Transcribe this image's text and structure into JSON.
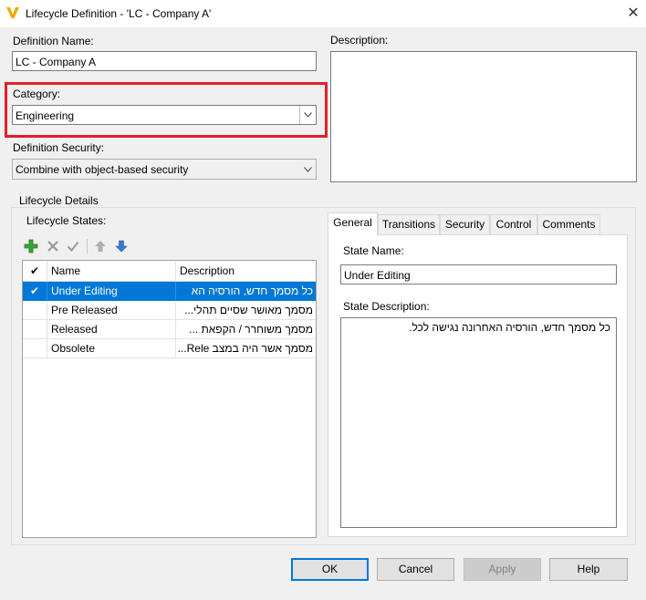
{
  "window": {
    "title": "Lifecycle Definition - 'LC - Company A'",
    "close_glyph": "✕"
  },
  "definition_name": {
    "label": "Definition Name:",
    "value": "LC - Company A"
  },
  "description": {
    "label": "Description:",
    "value": ""
  },
  "category": {
    "label": "Category:",
    "selected": "Engineering"
  },
  "definition_security": {
    "label": "Definition Security:",
    "selected": "Combine with object-based security"
  },
  "lifecycle_details": {
    "label": "Lifecycle Details",
    "states_label": "Lifecycle States:",
    "toolbar": [
      "add-icon",
      "delete-icon",
      "check-icon",
      "move-up-icon",
      "move-down-icon"
    ],
    "columns": [
      "✔",
      "Name",
      "Description"
    ],
    "states": [
      {
        "check": "✔",
        "name": "Under Editing",
        "description": "כל מסמך חדש, הורסיה הא"
      },
      {
        "check": "",
        "name": "Pre Released",
        "description": "מסמך מאושר שסיים תהלי..."
      },
      {
        "check": "",
        "name": "Released",
        "description": "מסמך משוחרר / הקפאת ..."
      },
      {
        "check": "",
        "name": "Obsolete",
        "description": "מסמך אשר היה במצב Rele..."
      }
    ]
  },
  "tabs": [
    {
      "label": "General",
      "active": true
    },
    {
      "label": "Transitions",
      "active": false
    },
    {
      "label": "Security",
      "active": false
    },
    {
      "label": "Control",
      "active": false
    },
    {
      "label": "Comments",
      "active": false
    }
  ],
  "general_tab": {
    "state_name_label": "State Name:",
    "state_name_value": "Under Editing",
    "state_description_label": "State Description:",
    "state_description_value": "כל מסמך חדש, הורסיה האחרונה נגישה לכל."
  },
  "buttons": {
    "ok": "OK",
    "cancel": "Cancel",
    "apply": "Apply",
    "help": "Help"
  },
  "colors": {
    "accent": "#0078d7",
    "highlight_box": "#e0202a",
    "logo": "#f2a900"
  }
}
